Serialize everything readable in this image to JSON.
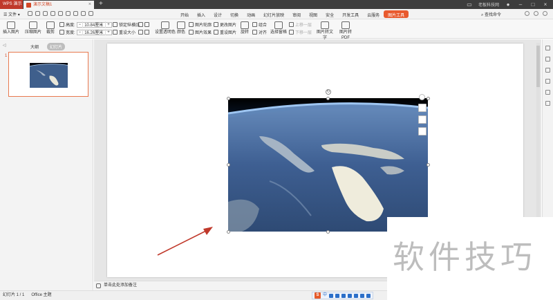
{
  "titlebar": {
    "app_tab": "WPS 演示",
    "doc_tab": "演示文稿1",
    "new_tab": "+",
    "user_name": "老板科技网",
    "accent_color": "#c0392b"
  },
  "menubar": {
    "file_label": "文件",
    "tabs": [
      "开始",
      "插入",
      "设计",
      "切换",
      "动画",
      "幻灯片放映",
      "审阅",
      "视图",
      "安全",
      "开发工具",
      "云服务",
      "图片工具"
    ],
    "active_tab": "图片工具",
    "search_label": "查找命令"
  },
  "ribbon": {
    "insert_picture": "插入图片",
    "compress_picture": "压缩图片",
    "crop": "裁剪",
    "height_label": "高度:",
    "height_value": "10.84厘米",
    "width_label": "宽度:",
    "width_value": "16.26厘米",
    "lock_ratio": "锁定纵横比",
    "reset_size": "重设大小",
    "set_transparent": "设置透明色",
    "color": "颜色",
    "picture_outline": "图片轮廓",
    "picture_effects": "图片效果",
    "change_picture": "更改图片",
    "reset_picture": "重设图片",
    "rotate": "旋转",
    "group": "组合",
    "align": "对齐",
    "bring_forward": "上移一层",
    "send_backward": "下移一层",
    "selection_pane": "选择窗格",
    "picture_to_text": "图片转文字",
    "picture_to_pdf": "图片转PDF"
  },
  "leftpane": {
    "tab_outline": "大纲",
    "tab_slides": "幻灯片",
    "slide_number": "1"
  },
  "notes": {
    "placeholder": "单击此处添加备注"
  },
  "statusbar": {
    "slide_info": "幻灯片 1 / 1",
    "theme": "Office 主题",
    "ime_logo": "S",
    "ime_mode": "中"
  },
  "watermark": {
    "text": "软件技巧"
  }
}
